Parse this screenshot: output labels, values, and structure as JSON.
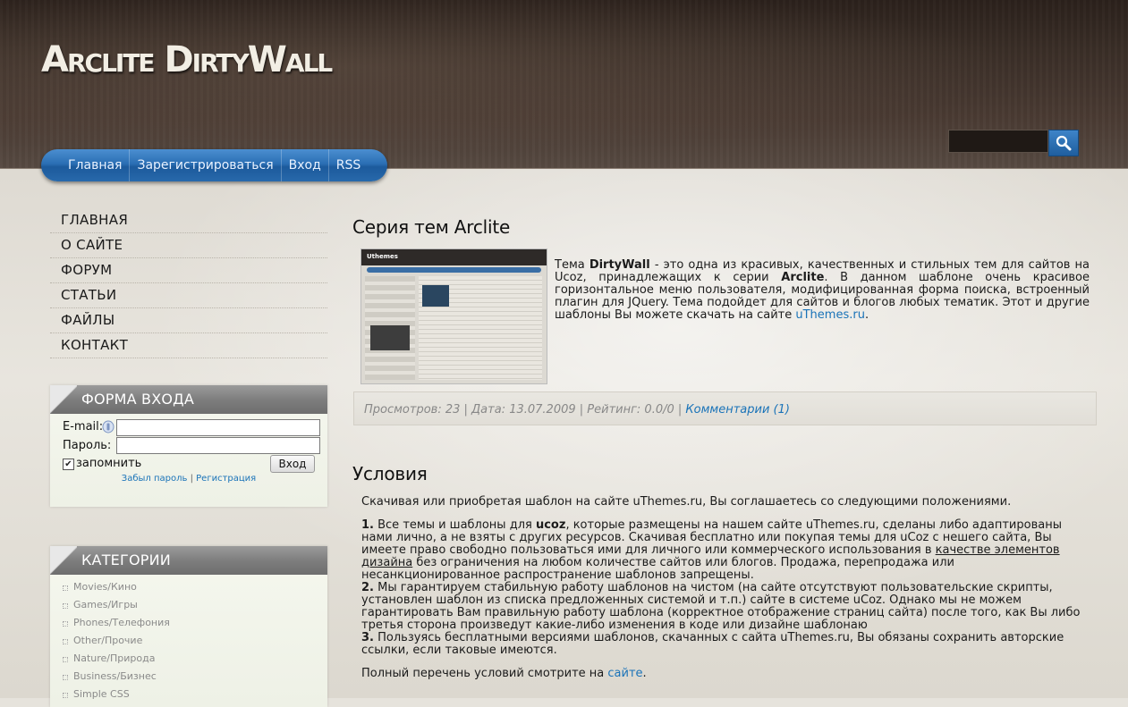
{
  "site": {
    "title": "Arclite DirtyWall"
  },
  "topnav": {
    "items": [
      "Главная",
      "Зарегистрироваться",
      "Вход",
      "RSS"
    ]
  },
  "search": {
    "placeholder": ""
  },
  "sidebar": {
    "menu": [
      "ГЛАВНАЯ",
      "О САЙТЕ",
      "ФОРУМ",
      "СТАТЬИ",
      "ФАЙЛЫ",
      "КОНТАКТ"
    ],
    "login": {
      "title": "ФОРМА ВХОДА",
      "email_label": "E-mail:",
      "password_label": "Пароль:",
      "remember_label": "запомнить",
      "submit_label": "Вход",
      "forgot_label": "Забыл пароль",
      "separator": "|",
      "register_label": "Регистрация"
    },
    "categories": {
      "title": "КАТЕГОРИИ",
      "items": [
        "Movies/Кино",
        "Games/Игры",
        "Phones/Телефония",
        "Other/Прочие",
        "Nature/Природа",
        "Business/Бизнес",
        "Simple CSS"
      ]
    }
  },
  "post": {
    "title": "Серия тем Arclite",
    "thumb_logo": "Uthemes",
    "intro": {
      "p1": "Тема ",
      "b1": "DirtyWall",
      "p2": " - это одна из красивых, качественных и стильных тем для сайтов на Ucoz, принадлежащих к серии ",
      "b2": "Arclite",
      "p3": ". В данном шаблоне очень красивое горизонтальное меню пользователя, модифицированная форма поиска, встроенный плагин для JQuery. Тема подойдет для сайтов и блогов любых тематик. Этот и другие шаблоны Вы можете скачать на сайте ",
      "link": "uThemes.ru",
      "p4": "."
    },
    "meta": {
      "text": "Просмотров: 23 | Дата: 13.07.2009 | Рейтинг: 0.0/0 | ",
      "comments": "Комментарии (1)"
    }
  },
  "terms": {
    "title": "Условия",
    "lead": "Скачивая или приобретая шаблон на сайте uThemes.ru, Вы соглашаетесь со следующими положениями.",
    "item1": {
      "num": "1.",
      "a": " Все темы и шаблоны для ",
      "b": "ucoz",
      "c": ", которые размещены на нашем сайте uThemes.ru, сделаны либо адаптированы нами лично, а не взяты с других ресурсов. Скачивая бесплатно или покупая темы для uCoz с нешего сайта, Вы имеете право свободно пользоваться ими для личного или коммерческого использования в ",
      "u": "качестве элементов дизайна",
      "d": " без ограничения на любом количестве сайтов или блогов. Продажа, перепродажа или несанкционированное распространение шаблонов запрещены."
    },
    "item2": {
      "num": "2.",
      "text": " Мы гарантируем стабильную работу шаблонов на чистом (на сайте отсутствуют пользовательские скрипты, установлен шаблон из списка предложенных системой и т.п.) сайте в системе uCoz. Однако мы не можем гарантировать Вам правильную работу шаблона (корректное отображение страниц сайта) после того, как Вы либо третья сторона произведут какие-либо изменения в коде или дизайне шаблонаю"
    },
    "item3": {
      "num": "3.",
      "text": " Пользуясь бесплатными версиями шаблонов, скачанных с сайта uThemes.ru, Вы обязаны сохранить авторские ссылки, если таковые имеются."
    },
    "footer_text": "Полный перечень условий смотрите на ",
    "footer_link": "сайте",
    "footer_end": "."
  },
  "colors": {
    "accent": "#1a73b8",
    "nav_blue": "#2b6fb4",
    "header_brown": "#3a2e27"
  }
}
